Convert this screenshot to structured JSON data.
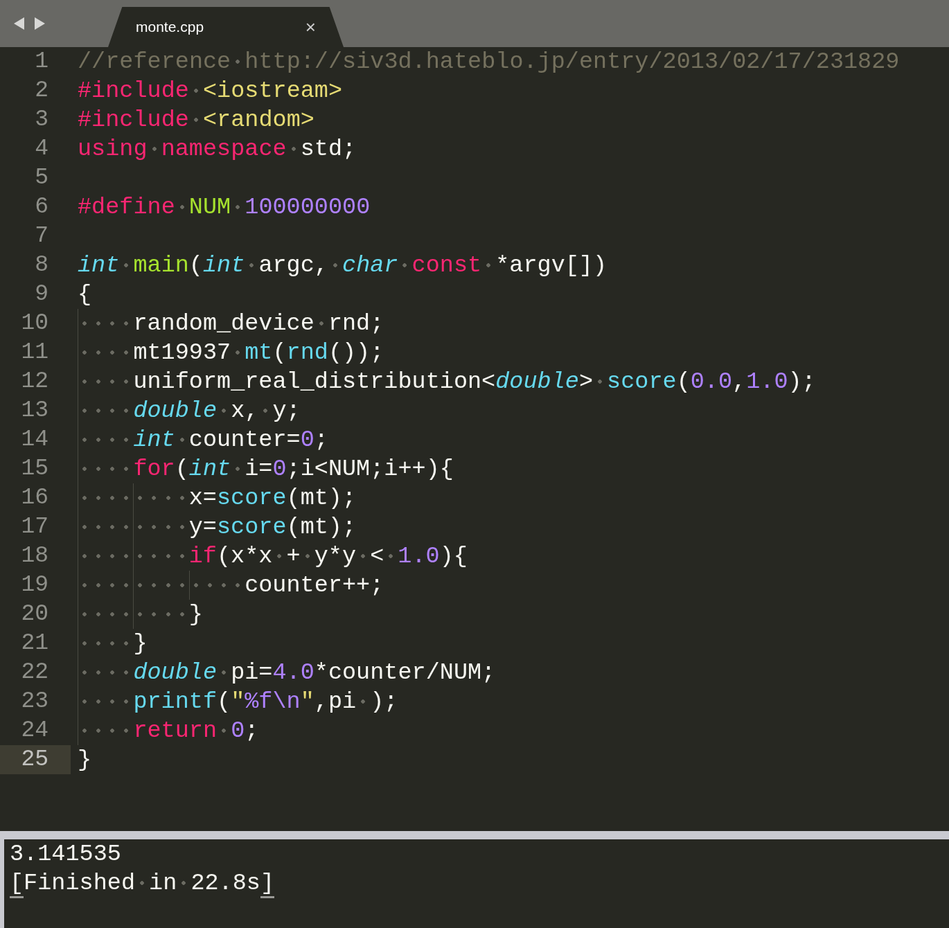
{
  "tabs": [
    {
      "label": "monte.cpp",
      "close": "×",
      "selected": true
    }
  ],
  "lines": [
    {
      "number": "1",
      "current": false,
      "tokens": [
        {
          "kind": "comment",
          "t": "//reference http://siv3d.hateblo.jp/entry/2013/02/17/231829"
        }
      ]
    },
    {
      "number": "2",
      "current": false,
      "tokens": [
        {
          "kind": "keyword",
          "t": "#include "
        },
        {
          "kind": "string",
          "t": "<iostream>"
        }
      ]
    },
    {
      "number": "3",
      "current": false,
      "tokens": [
        {
          "kind": "keyword",
          "t": "#include "
        },
        {
          "kind": "string",
          "t": "<random>"
        }
      ]
    },
    {
      "number": "4",
      "current": false,
      "tokens": [
        {
          "kind": "keyword",
          "t": "using "
        },
        {
          "kind": "keyword",
          "t": "namespace "
        },
        {
          "kind": "plain",
          "t": "std;"
        }
      ]
    },
    {
      "number": "5",
      "current": false
    },
    {
      "number": "6",
      "current": false,
      "tokens": [
        {
          "kind": "keyword",
          "t": "#define "
        },
        {
          "kind": "entity",
          "t": "NUM "
        },
        {
          "kind": "number",
          "t": "100000000"
        }
      ]
    },
    {
      "number": "7",
      "current": false
    },
    {
      "number": "8",
      "current": false,
      "tokens": [
        {
          "kind": "type",
          "t": "int "
        },
        {
          "kind": "entity",
          "t": "main"
        },
        {
          "kind": "plain",
          "t": "("
        },
        {
          "kind": "type",
          "t": "int "
        },
        {
          "kind": "plain",
          "t": "argc, "
        },
        {
          "kind": "type",
          "t": "char "
        },
        {
          "kind": "keyword",
          "t": "const "
        },
        {
          "kind": "plain",
          "t": "*argv[])"
        }
      ]
    },
    {
      "number": "9",
      "current": false,
      "tokens": [
        {
          "kind": "plain",
          "t": "{"
        }
      ]
    },
    {
      "number": "10",
      "current": false,
      "tokens": [
        {
          "kind": "plain",
          "t": "    random_device rnd;"
        }
      ]
    },
    {
      "number": "11",
      "current": false,
      "tokens": [
        {
          "kind": "plain",
          "t": "    mt19937 "
        },
        {
          "kind": "call",
          "t": "mt"
        },
        {
          "kind": "plain",
          "t": "("
        },
        {
          "kind": "call",
          "t": "rnd"
        },
        {
          "kind": "plain",
          "t": "());"
        }
      ]
    },
    {
      "number": "12",
      "current": false,
      "tokens": [
        {
          "kind": "plain",
          "t": "    uniform_real_distribution<"
        },
        {
          "kind": "type",
          "t": "double"
        },
        {
          "kind": "plain",
          "t": "> "
        },
        {
          "kind": "call",
          "t": "score"
        },
        {
          "kind": "plain",
          "t": "("
        },
        {
          "kind": "number",
          "t": "0.0"
        },
        {
          "kind": "plain",
          "t": ","
        },
        {
          "kind": "number",
          "t": "1.0"
        },
        {
          "kind": "plain",
          "t": ");"
        }
      ]
    },
    {
      "number": "13",
      "current": false,
      "tokens": [
        {
          "kind": "type",
          "t": "    double "
        },
        {
          "kind": "plain",
          "t": "x, y;"
        }
      ]
    },
    {
      "number": "14",
      "current": false,
      "tokens": [
        {
          "kind": "type",
          "t": "    int "
        },
        {
          "kind": "plain",
          "t": "counter="
        },
        {
          "kind": "number",
          "t": "0"
        },
        {
          "kind": "plain",
          "t": ";"
        }
      ]
    },
    {
      "number": "15",
      "current": false,
      "tokens": [
        {
          "kind": "keyword",
          "t": "    for"
        },
        {
          "kind": "plain",
          "t": "("
        },
        {
          "kind": "type",
          "t": "int "
        },
        {
          "kind": "plain",
          "t": "i="
        },
        {
          "kind": "number",
          "t": "0"
        },
        {
          "kind": "plain",
          "t": ";i<NUM;i++){"
        }
      ]
    },
    {
      "number": "16",
      "current": false,
      "tokens": [
        {
          "kind": "plain",
          "t": "        x="
        },
        {
          "kind": "call",
          "t": "score"
        },
        {
          "kind": "plain",
          "t": "(mt);"
        }
      ]
    },
    {
      "number": "17",
      "current": false,
      "tokens": [
        {
          "kind": "plain",
          "t": "        y="
        },
        {
          "kind": "call",
          "t": "score"
        },
        {
          "kind": "plain",
          "t": "(mt);"
        }
      ]
    },
    {
      "number": "18",
      "current": false,
      "tokens": [
        {
          "kind": "keyword",
          "t": "        if"
        },
        {
          "kind": "plain",
          "t": "(x*x + y*y < "
        },
        {
          "kind": "number",
          "t": "1.0"
        },
        {
          "kind": "plain",
          "t": "){"
        }
      ]
    },
    {
      "number": "19",
      "current": false,
      "tokens": [
        {
          "kind": "plain",
          "t": "            counter++;"
        }
      ]
    },
    {
      "number": "20",
      "current": false,
      "tokens": [
        {
          "kind": "plain",
          "t": "        }"
        }
      ]
    },
    {
      "number": "21",
      "current": false,
      "tokens": [
        {
          "kind": "plain",
          "t": "    }"
        }
      ]
    },
    {
      "number": "22",
      "current": false,
      "tokens": [
        {
          "kind": "type",
          "t": "    double "
        },
        {
          "kind": "plain",
          "t": "pi="
        },
        {
          "kind": "number",
          "t": "4.0"
        },
        {
          "kind": "plain",
          "t": "*counter/NUM;"
        }
      ]
    },
    {
      "number": "23",
      "current": false,
      "tokens": [
        {
          "kind": "call",
          "t": "    printf"
        },
        {
          "kind": "plain",
          "t": "("
        },
        {
          "kind": "string",
          "t": "\""
        },
        {
          "kind": "number",
          "t": "%f"
        },
        {
          "kind": "number",
          "t": "\\n"
        },
        {
          "kind": "string",
          "t": "\""
        },
        {
          "kind": "plain",
          "t": ",pi );"
        }
      ]
    },
    {
      "number": "24",
      "current": false,
      "tokens": [
        {
          "kind": "keyword",
          "t": "    return "
        },
        {
          "kind": "number",
          "t": "0"
        },
        {
          "kind": "plain",
          "t": ";"
        }
      ]
    },
    {
      "number": "25",
      "current": true,
      "tokens": [
        {
          "kind": "plain",
          "t": "}"
        }
      ]
    }
  ],
  "output": [
    {
      "tokens": [
        {
          "kind": "plain",
          "t": "3.141535"
        }
      ]
    },
    {
      "tokens": [
        {
          "kind": "bracket",
          "t": "["
        },
        {
          "kind": "plain",
          "t": "Finished in 22.8s"
        },
        {
          "kind": "bracket",
          "t": "]"
        }
      ]
    }
  ]
}
